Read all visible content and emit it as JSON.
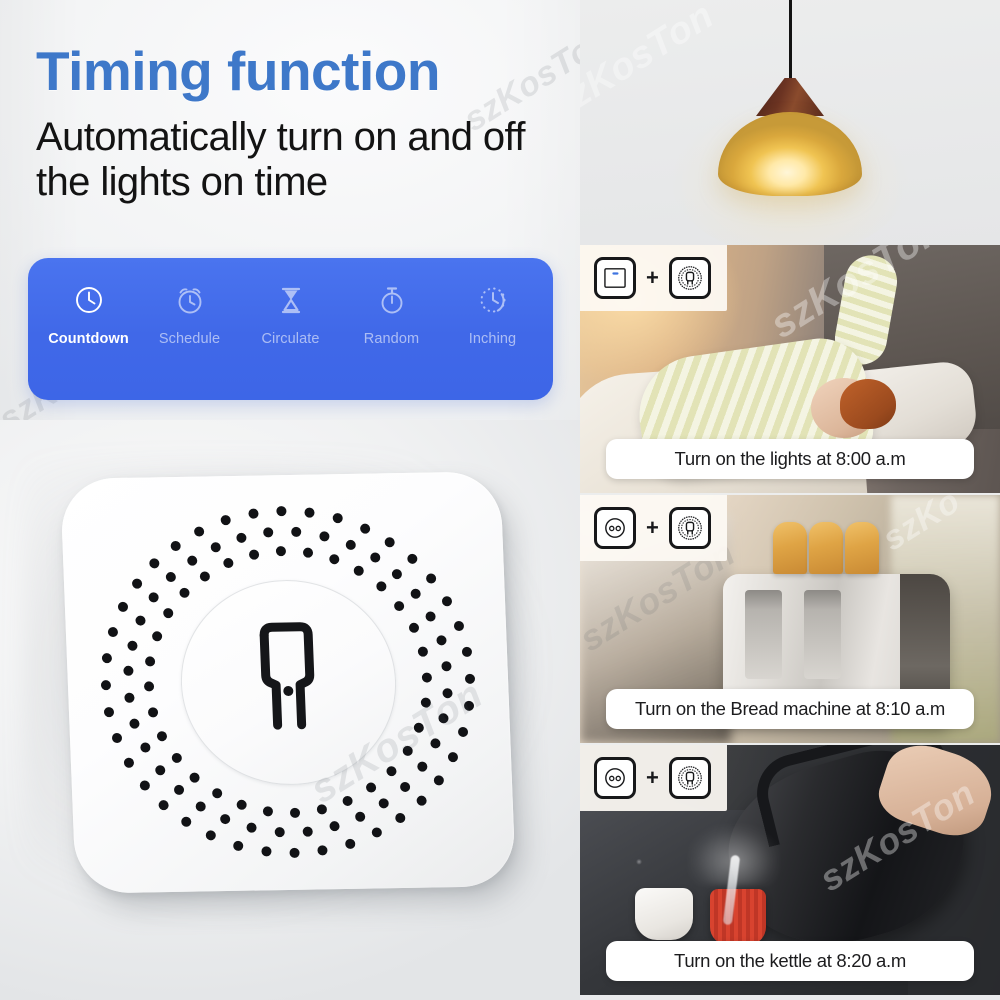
{
  "left": {
    "title": "Timing function",
    "subtitle": "Automatically turn on and off the lights on time",
    "accent_title_color": "#3e78c9",
    "accent_bar_color": "#4068e8",
    "feature_bar": {
      "items": [
        {
          "label": "Countdown",
          "icon": "clock-icon",
          "active": true
        },
        {
          "label": "Schedule",
          "icon": "alarm-clock-icon",
          "active": false
        },
        {
          "label": "Circulate",
          "icon": "hourglass-icon",
          "active": false
        },
        {
          "label": "Random",
          "icon": "stopwatch-icon",
          "active": false
        },
        {
          "label": "Inching",
          "icon": "dotted-clock-icon",
          "active": false
        }
      ]
    },
    "product": {
      "name": "smart-switch-module",
      "center_glyph": "plug-prong-icon",
      "body_color": "#ffffff",
      "dot_color": "#111215"
    },
    "watermarks": [
      "szKosTon",
      "szKosTon",
      "szKosTon"
    ]
  },
  "right": {
    "hero": {
      "name": "pendant-lamp",
      "shade_color": "#e8c05a",
      "cap_color": "#6b3322",
      "cord_color": "#131313"
    },
    "cards": [
      {
        "caption": "Turn on the lights at 8:00 a.m",
        "devices": [
          {
            "icon": "wall-switch-icon",
            "name": "wall-switch"
          },
          {
            "icon": "light-bulb-icon",
            "name": "light-bulb"
          }
        ],
        "plus": "+",
        "scene": "bedroom-waking-up"
      },
      {
        "caption": "Turn on the Bread machine at 8:10 a.m",
        "devices": [
          {
            "icon": "power-socket-icon",
            "name": "power-socket"
          },
          {
            "icon": "light-bulb-icon",
            "name": "light-bulb"
          }
        ],
        "plus": "+",
        "scene": "kitchen-toaster"
      },
      {
        "caption": "Turn on the kettle at 8:20 a.m",
        "devices": [
          {
            "icon": "power-socket-icon",
            "name": "power-socket"
          },
          {
            "icon": "light-bulb-icon",
            "name": "light-bulb"
          }
        ],
        "plus": "+",
        "scene": "kitchen-kettle-pouring"
      }
    ],
    "watermarks": [
      "szKosTon",
      "szKosTon",
      "szKosTon"
    ]
  }
}
